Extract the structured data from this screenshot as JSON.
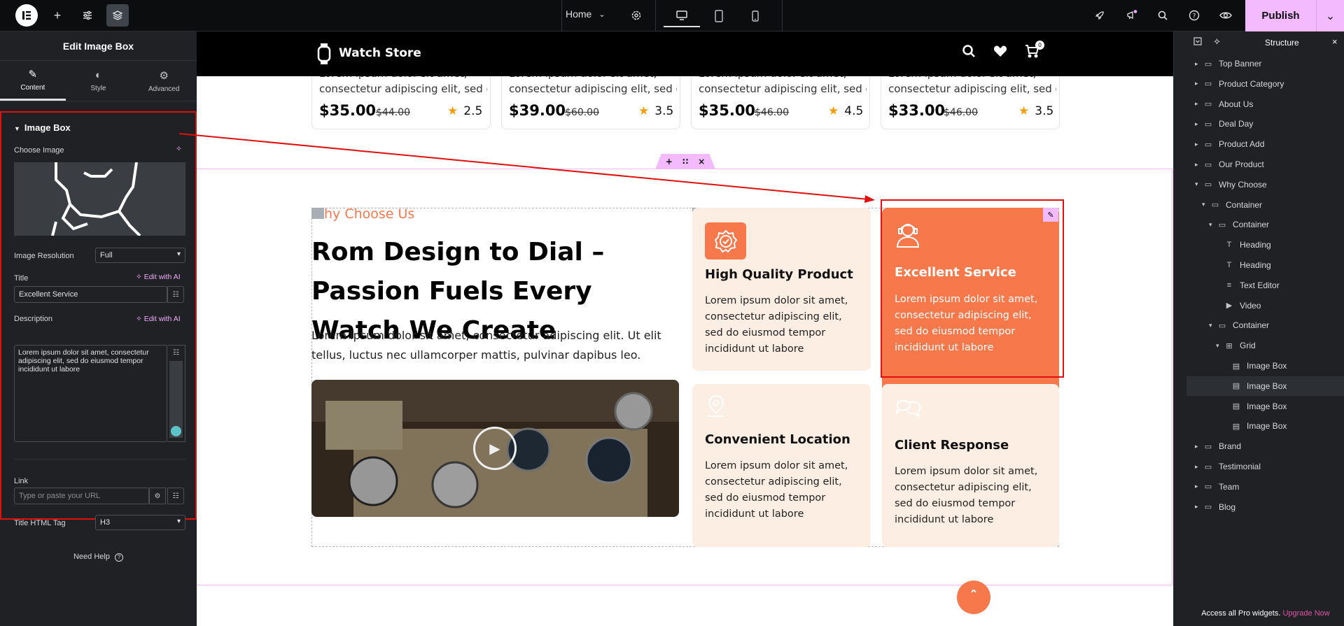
{
  "topbar": {
    "page_name": "Home",
    "publish_label": "Publish"
  },
  "left_panel": {
    "title": "Edit Image Box",
    "tabs": [
      {
        "label": "Content",
        "icon": "pencil-icon"
      },
      {
        "label": "Style",
        "icon": "contrast-icon"
      },
      {
        "label": "Advanced",
        "icon": "gear-icon"
      }
    ],
    "section_title": "Image Box",
    "choose_image_label": "Choose Image",
    "image_resolution_label": "Image Resolution",
    "image_resolution_value": "Full",
    "title_label": "Title",
    "title_value": "Excellent Service",
    "edit_with_ai": "Edit with AI",
    "description_label": "Description",
    "description_value": "Lorem ipsum dolor sit amet, consectetur adipiscing elit, sed do eiusmod tempor incididunt ut labore",
    "link_label": "Link",
    "link_placeholder": "Type or paste your URL",
    "title_tag_label": "Title HTML Tag",
    "title_tag_value": "H3",
    "need_help": "Need Help"
  },
  "site": {
    "store_name": "Watch Store",
    "cart_count": "0",
    "products": [
      {
        "desc1": "Lorem ipsum dolor sit amet,",
        "desc2": "consectetur adipiscing elit, sed d...",
        "price": "$35.00",
        "old_price": "$44.00",
        "rating": "2.5"
      },
      {
        "desc1": "Lorem ipsum dolor sit amet,",
        "desc2": "consectetur adipiscing elit, sed d...",
        "price": "$39.00",
        "old_price": "$60.00",
        "rating": "3.5"
      },
      {
        "desc1": "Lorem ipsum dolor sit amet,",
        "desc2": "consectetur adipiscing elit, sed d...",
        "price": "$35.00",
        "old_price": "$46.00",
        "rating": "4.5"
      },
      {
        "desc1": "Lorem ipsum dolor sit amet,",
        "desc2": "consectetur adipiscing elit, sed d...",
        "price": "$33.00",
        "old_price": "$46.00",
        "rating": "3.5"
      }
    ],
    "why_label": "hy Choose Us",
    "why_heading": "Rom Design to Dial – Passion Fuels Every Watch We Create",
    "why_text": "Lorem ipsum dolor sit amet, consectetur adipiscing elit. Ut elit tellus, luctus nec ullamcorper mattis, pulvinar dapibus leo.",
    "features": [
      {
        "title": "High Quality Product",
        "text": "Lorem ipsum dolor sit amet, consectetur adipiscing elit, sed do eiusmod tempor incididunt ut labore"
      },
      {
        "title": "Excellent Service",
        "text": "Lorem ipsum dolor sit amet, consectetur adipiscing elit, sed do eiusmod tempor incididunt ut labore"
      },
      {
        "title": "Convenient Location",
        "text": "Lorem ipsum dolor sit amet, consectetur adipiscing elit, sed do eiusmod tempor incididunt ut labore"
      },
      {
        "title": "Client Response",
        "text": "Lorem ipsum dolor sit amet, consectetur adipiscing elit, sed do eiusmod tempor incididunt ut labore"
      }
    ]
  },
  "structure": {
    "title": "Structure",
    "items": [
      {
        "label": "Top Banner",
        "depth": 0,
        "icon": "container-icon",
        "expanded": false
      },
      {
        "label": "Product Category",
        "depth": 0,
        "icon": "container-icon",
        "expanded": false
      },
      {
        "label": "About Us",
        "depth": 0,
        "icon": "container-icon",
        "expanded": false
      },
      {
        "label": "Deal Day",
        "depth": 0,
        "icon": "container-icon",
        "expanded": false
      },
      {
        "label": "Product Add",
        "depth": 0,
        "icon": "container-icon",
        "expanded": false
      },
      {
        "label": "Our Product",
        "depth": 0,
        "icon": "container-icon",
        "expanded": false
      },
      {
        "label": "Why Choose",
        "depth": 0,
        "icon": "container-icon",
        "expanded": true
      },
      {
        "label": "Container",
        "depth": 1,
        "icon": "container-icon",
        "expanded": true
      },
      {
        "label": "Container",
        "depth": 2,
        "icon": "container-icon",
        "expanded": true
      },
      {
        "label": "Heading",
        "depth": 3,
        "icon": "heading-icon"
      },
      {
        "label": "Heading",
        "depth": 3,
        "icon": "heading-icon"
      },
      {
        "label": "Text Editor",
        "depth": 3,
        "icon": "text-editor-icon"
      },
      {
        "label": "Video",
        "depth": 3,
        "icon": "video-icon"
      },
      {
        "label": "Container",
        "depth": 2,
        "icon": "container-icon",
        "expanded": true
      },
      {
        "label": "Grid",
        "depth": 3,
        "icon": "grid-icon",
        "expanded": true
      },
      {
        "label": "Image Box",
        "depth": 4,
        "icon": "image-box-icon"
      },
      {
        "label": "Image Box",
        "depth": 4,
        "icon": "image-box-icon",
        "active": true
      },
      {
        "label": "Image Box",
        "depth": 4,
        "icon": "image-box-icon"
      },
      {
        "label": "Image Box",
        "depth": 4,
        "icon": "image-box-icon"
      },
      {
        "label": "Brand",
        "depth": 0,
        "icon": "container-icon",
        "expanded": false
      },
      {
        "label": "Testimonial",
        "depth": 0,
        "icon": "container-icon",
        "expanded": false
      },
      {
        "label": "Team",
        "depth": 0,
        "icon": "container-icon",
        "expanded": false
      },
      {
        "label": "Blog",
        "depth": 0,
        "icon": "container-icon",
        "expanded": false
      }
    ],
    "promo_text": "Access all Pro widgets.",
    "promo_link": "Upgrade Now"
  },
  "colors": {
    "accent": "#f7784a",
    "publish": "#f3bafd",
    "selection": "#e20f0f"
  }
}
